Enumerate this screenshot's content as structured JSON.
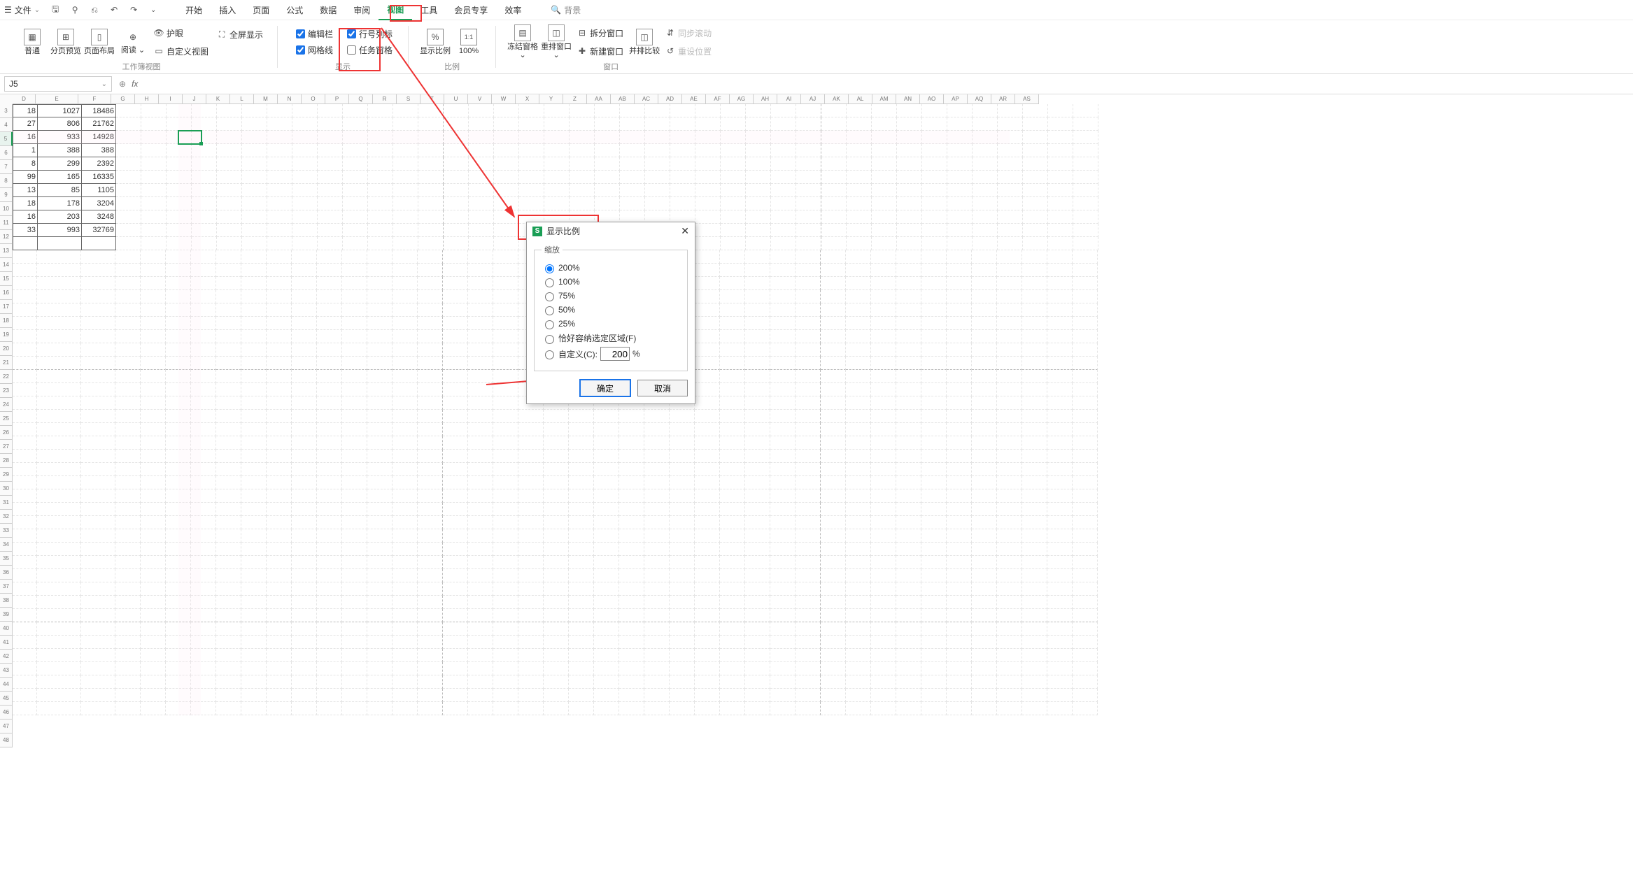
{
  "topbar": {
    "file": "文件",
    "search": "背景"
  },
  "tabs": {
    "start": "开始",
    "insert": "插入",
    "page": "页面",
    "formula": "公式",
    "data": "数据",
    "review": "审阅",
    "view": "视图",
    "tools": "工具",
    "member": "会员专享",
    "efficiency": "效率"
  },
  "ribbon": {
    "group_view": "工作簿视图",
    "normal": "普通",
    "pagebreak": "分页预览",
    "pagelayout": "页面布局",
    "read": "阅读",
    "eye": "护眼",
    "fullscreen": "全屏显示",
    "customview": "自定义视图",
    "group_show": "显示",
    "formulabar": "编辑栏",
    "rowcol": "行号列标",
    "gridlines": "网格线",
    "taskpane": "任务窗格",
    "group_scale": "比例",
    "zoom": "显示比例",
    "hundred": "100%",
    "group_window": "窗口",
    "freeze": "冻结窗格",
    "arrange": "重排窗口",
    "split": "拆分窗口",
    "newwin": "新建窗口",
    "sidebyside": "并排比较",
    "syncscroll": "同步滚动",
    "resetpos": "重设位置"
  },
  "namebox": "J5",
  "columns": [
    "D",
    "E",
    "F",
    "G",
    "H",
    "I",
    "J",
    "K",
    "L",
    "M",
    "N",
    "O",
    "P",
    "Q",
    "R",
    "S",
    "T",
    "U",
    "V",
    "W",
    "X",
    "Y",
    "Z",
    "AA",
    "AB",
    "AC",
    "AD",
    "AE",
    "AF",
    "AG",
    "AH",
    "AI",
    "AJ",
    "AK",
    "AL",
    "AM",
    "AN",
    "AO",
    "AP",
    "AQ",
    "AR",
    "AS"
  ],
  "rows": [
    3,
    4,
    5,
    6,
    7,
    8,
    9,
    10,
    11,
    12,
    13,
    14,
    15,
    16,
    17,
    18,
    19,
    20,
    21,
    22,
    23,
    24,
    25,
    26,
    27,
    28,
    29,
    30,
    31,
    32,
    33,
    34,
    35,
    36,
    37,
    38,
    39,
    40,
    41,
    42,
    43,
    44,
    45,
    46,
    47,
    48
  ],
  "data_rows": [
    {
      "d": "18",
      "e": "1027",
      "f": "18486"
    },
    {
      "d": "27",
      "e": "806",
      "f": "21762"
    },
    {
      "d": "16",
      "e": "933",
      "f": "14928"
    },
    {
      "d": "1",
      "e": "388",
      "f": "388"
    },
    {
      "d": "8",
      "e": "299",
      "f": "2392"
    },
    {
      "d": "99",
      "e": "165",
      "f": "16335"
    },
    {
      "d": "13",
      "e": "85",
      "f": "1105"
    },
    {
      "d": "18",
      "e": "178",
      "f": "3204"
    },
    {
      "d": "16",
      "e": "203",
      "f": "3248"
    },
    {
      "d": "33",
      "e": "993",
      "f": "32769"
    }
  ],
  "dialog": {
    "title": "显示比例",
    "group": "缩放",
    "opt200": "200%",
    "opt100": "100%",
    "opt75": "75%",
    "opt50": "50%",
    "opt25": "25%",
    "optfit": "恰好容纳选定区域(F)",
    "optcustom": "自定义(C):",
    "customval": "200",
    "pct": "%",
    "ok": "确定",
    "cancel": "取消"
  }
}
